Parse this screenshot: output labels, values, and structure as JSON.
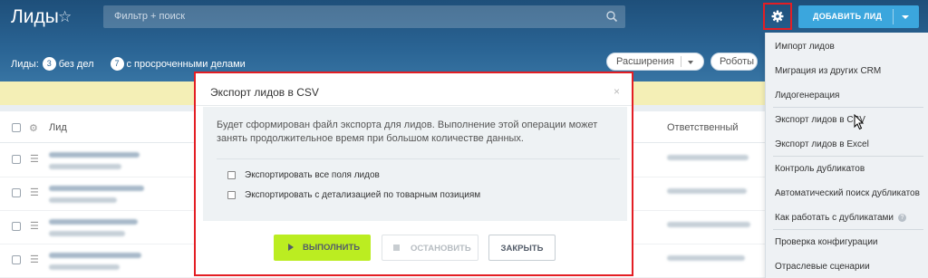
{
  "header": {
    "title": "Лиды",
    "search_placeholder": "Фильтр + поиск",
    "add_button": "ДОБАВИТЬ ЛИД"
  },
  "counters": {
    "label": "Лиды:",
    "no_tasks_count": "3",
    "no_tasks_label": "без дел",
    "overdue_count": "7",
    "overdue_label": "с просроченными делами"
  },
  "toolbar": {
    "extensions": "Расширения",
    "robots": "Роботы"
  },
  "table": {
    "col_lead": "Лид",
    "col_responsible": "Ответственный"
  },
  "menu": {
    "items": [
      "Импорт лидов",
      "Миграция из других CRM",
      "Лидогенерация",
      "Экспорт лидов в CSV",
      "Экспорт лидов в Excel",
      "Контроль дубликатов",
      "Автоматический поиск дубликатов",
      "Как работать с дубликатами",
      "Проверка конфигурации",
      "Отраслевые сценарии"
    ]
  },
  "modal": {
    "title": "Экспорт лидов в CSV",
    "close": "×",
    "description": "Будет сформирован файл экспорта для лидов. Выполнение этой операции может занять продолжительное время при большом количестве данных.",
    "option_all_fields": "Экспортировать все поля лидов",
    "option_product_details": "Экспортировать с детализацией по товарным позициям",
    "run_button": "ВЫПОЛНИТЬ",
    "stop_button": "ОСТАНОВИТЬ",
    "close_button": "ЗАКРЫТЬ"
  },
  "colors": {
    "header_blue": "#2a6494",
    "accent_blue": "#3ba6dd",
    "run_green": "#bbed21",
    "highlight_red": "#e31e24"
  }
}
